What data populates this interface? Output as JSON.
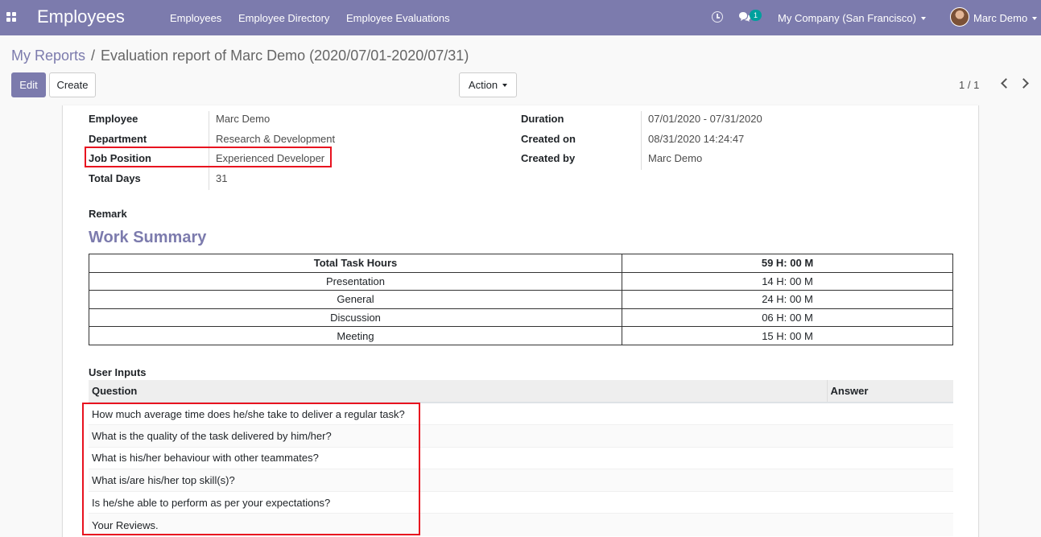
{
  "navbar": {
    "app_title": "Employees",
    "menu": [
      {
        "label": "Employees"
      },
      {
        "label": "Employee Directory"
      },
      {
        "label": "Employee Evaluations"
      }
    ],
    "message_count": "1",
    "company": "My Company (San Francisco)",
    "user": "Marc Demo"
  },
  "breadcrumb": {
    "parent": "My Reports",
    "current": "Evaluation report of Marc Demo (2020/07/01-2020/07/31)"
  },
  "toolbar": {
    "edit_label": "Edit",
    "create_label": "Create",
    "action_label": "Action",
    "pager": "1 / 1"
  },
  "form": {
    "left_fields": [
      {
        "label": "Employee",
        "value": "Marc Demo"
      },
      {
        "label": "Department",
        "value": "Research & Development"
      },
      {
        "label": "Job Position",
        "value": "Experienced Developer"
      },
      {
        "label": "Total Days",
        "value": "31"
      }
    ],
    "right_fields": [
      {
        "label": "Duration",
        "value": "07/01/2020 - 07/31/2020"
      },
      {
        "label": "Created on",
        "value": "08/31/2020 14:24:47"
      },
      {
        "label": "Created by",
        "value": "Marc Demo"
      }
    ],
    "remark_label": "Remark",
    "work_summary_title": "Work Summary",
    "work_summary": {
      "header": {
        "label": "Total Task Hours",
        "value": "59 H: 00 M"
      },
      "rows": [
        {
          "label": "Presentation",
          "value": "14 H: 00 M"
        },
        {
          "label": "General",
          "value": "24 H: 00 M"
        },
        {
          "label": "Discussion",
          "value": "06 H: 00 M"
        },
        {
          "label": "Meeting",
          "value": "15 H: 00 M"
        }
      ]
    },
    "user_inputs_label": "User Inputs",
    "user_inputs": {
      "columns": [
        "Question",
        "Answer"
      ],
      "rows": [
        {
          "question": "How much average time does he/she take to deliver a regular task?",
          "answer": ""
        },
        {
          "question": "What is the quality of the task delivered by him/her?",
          "answer": ""
        },
        {
          "question": "What is his/her behaviour with other teammates?",
          "answer": ""
        },
        {
          "question": "What is/are his/her top skill(s)?",
          "answer": ""
        },
        {
          "question": "Is he/she able to perform as per your expectations?",
          "answer": ""
        },
        {
          "question": "Your Reviews.",
          "answer": ""
        }
      ]
    }
  },
  "colors": {
    "brand": "#7c7bad",
    "highlight": "#e8121f",
    "badge": "#00a09d"
  }
}
